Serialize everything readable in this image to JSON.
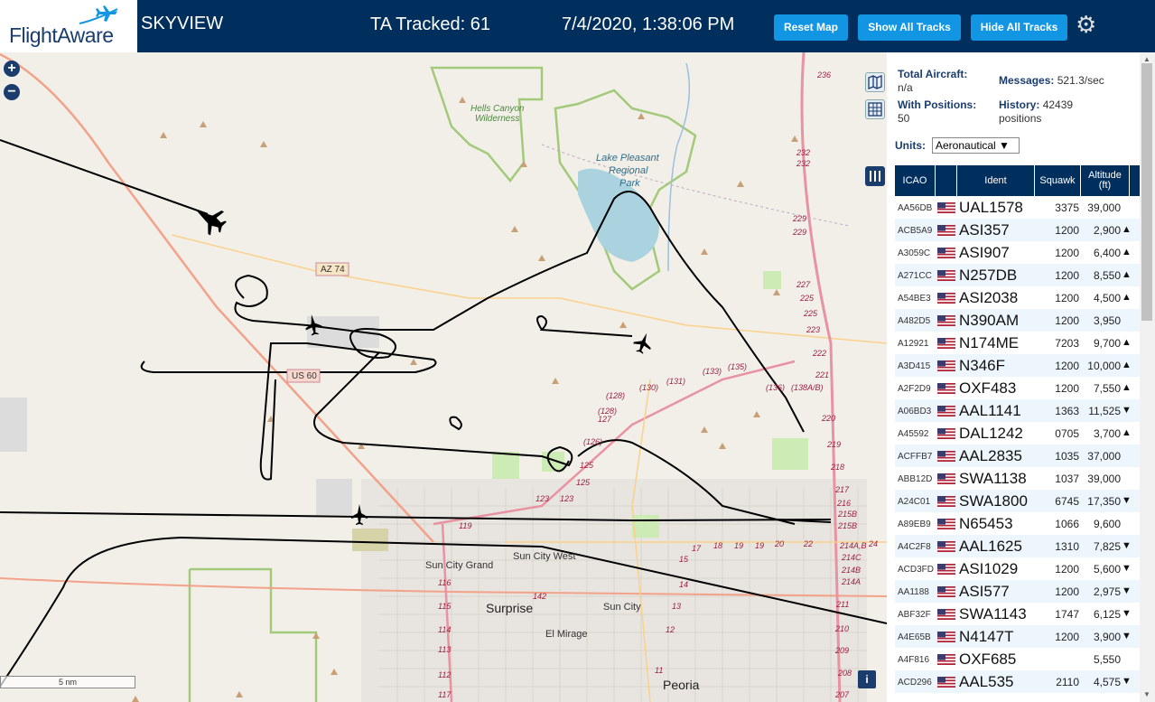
{
  "header": {
    "logo": "FlightAware",
    "title": "SKYVIEW",
    "ta_tracked": "TA Tracked: 61",
    "datetime": "7/4/2020, 1:38:06 PM",
    "buttons": {
      "reset": "Reset Map",
      "show": "Show All Tracks",
      "hide": "Hide All Tracks"
    },
    "settings_icon": "gear-icon"
  },
  "map": {
    "labels": {
      "hells_canyon": "Hells Canyon",
      "wilderness": "Wilderness",
      "lake1": "Lake Pleasant",
      "lake2": "Regional",
      "lake3": "Park",
      "az74": "AZ 74",
      "us60": "US 60",
      "sun_city_grand": "Sun City Grand",
      "sun_city_west": "Sun City West",
      "surprise": "Surprise",
      "sun_city": "Sun City",
      "el_mirage": "El Mirage",
      "peoria": "Peoria",
      "scale": "5 nm"
    },
    "route_numbers": [
      "236",
      "232",
      "232",
      "229",
      "229",
      "227",
      "225",
      "225",
      "223",
      "222",
      "221",
      "220",
      "219",
      "218",
      "217",
      "216",
      "215B",
      "215B",
      "214A,B",
      "214C",
      "214B",
      "214A",
      "211",
      "210",
      "209",
      "207",
      "208",
      "(136)",
      "(138A/B)",
      "(135)",
      "(133)",
      "(131)",
      "(130)",
      "(128)",
      "(128)",
      "127",
      "(126)",
      "125",
      "125",
      "123",
      "123",
      "119",
      "116",
      "115",
      "114",
      "113",
      "112",
      "117",
      "142",
      "17",
      "18",
      "19",
      "19",
      "20",
      "22",
      "24",
      "15",
      "14",
      "13",
      "12",
      "11"
    ]
  },
  "sidebar": {
    "total_aircraft_label": "Total Aircraft:",
    "total_aircraft_value": "n/a",
    "with_positions_label": "With Positions:",
    "with_positions_value": "50",
    "messages_label": "Messages:",
    "messages_value": "521.3/sec",
    "history_label": "History:",
    "history_value": "42439",
    "history_unit": "positions",
    "units_label": "Units:",
    "units_value": "Aeronautical ▼",
    "columns": {
      "icao": "ICAO",
      "ident": "Ident",
      "squawk": "Squawk",
      "alt1": "Altitude",
      "alt2": "(ft)"
    },
    "rows": [
      {
        "icao": "AA56DB",
        "ident": "UAL1578",
        "squawk": "3375",
        "alt": "39,000",
        "trend": ""
      },
      {
        "icao": "ACB5A9",
        "ident": "ASI357",
        "squawk": "1200",
        "alt": "2,900",
        "trend": "▲"
      },
      {
        "icao": "A3059C",
        "ident": "ASI907",
        "squawk": "1200",
        "alt": "6,400",
        "trend": "▲"
      },
      {
        "icao": "A271CC",
        "ident": "N257DB",
        "squawk": "1200",
        "alt": "8,550",
        "trend": "▲"
      },
      {
        "icao": "A54BE3",
        "ident": "ASI2038",
        "squawk": "1200",
        "alt": "4,500",
        "trend": "▲"
      },
      {
        "icao": "A482D5",
        "ident": "N390AM",
        "squawk": "1200",
        "alt": "3,950",
        "trend": ""
      },
      {
        "icao": "A12921",
        "ident": "N174ME",
        "squawk": "7203",
        "alt": "9,700",
        "trend": "▲"
      },
      {
        "icao": "A3D415",
        "ident": "N346F",
        "squawk": "1200",
        "alt": "10,000",
        "trend": "▲"
      },
      {
        "icao": "A2F2D9",
        "ident": "OXF483",
        "squawk": "1200",
        "alt": "7,550",
        "trend": "▲"
      },
      {
        "icao": "A06BD3",
        "ident": "AAL1141",
        "squawk": "1363",
        "alt": "11,525",
        "trend": "▼"
      },
      {
        "icao": "A45592",
        "ident": "DAL1242",
        "squawk": "0705",
        "alt": "3,700",
        "trend": "▲"
      },
      {
        "icao": "ACFFB7",
        "ident": "AAL2835",
        "squawk": "1035",
        "alt": "37,000",
        "trend": ""
      },
      {
        "icao": "ABB12D",
        "ident": "SWA1138",
        "squawk": "1037",
        "alt": "39,000",
        "trend": ""
      },
      {
        "icao": "A24C01",
        "ident": "SWA1800",
        "squawk": "6745",
        "alt": "17,350",
        "trend": "▼"
      },
      {
        "icao": "A89EB9",
        "ident": "N65453",
        "squawk": "1066",
        "alt": "9,600",
        "trend": ""
      },
      {
        "icao": "A4C2F8",
        "ident": "AAL1625",
        "squawk": "1310",
        "alt": "7,825",
        "trend": "▼"
      },
      {
        "icao": "ACD3FD",
        "ident": "ASI1029",
        "squawk": "1200",
        "alt": "5,600",
        "trend": "▼"
      },
      {
        "icao": "AA1188",
        "ident": "ASI577",
        "squawk": "1200",
        "alt": "2,975",
        "trend": "▼"
      },
      {
        "icao": "ABF32F",
        "ident": "SWA1143",
        "squawk": "1747",
        "alt": "6,125",
        "trend": "▼"
      },
      {
        "icao": "A4E65B",
        "ident": "N4147T",
        "squawk": "1200",
        "alt": "3,900",
        "trend": "▼"
      },
      {
        "icao": "A4F816",
        "ident": "OXF685",
        "squawk": "",
        "alt": "5,550",
        "trend": ""
      },
      {
        "icao": "ACD296",
        "ident": "AAL535",
        "squawk": "2110",
        "alt": "4,575",
        "trend": "▼"
      }
    ]
  }
}
